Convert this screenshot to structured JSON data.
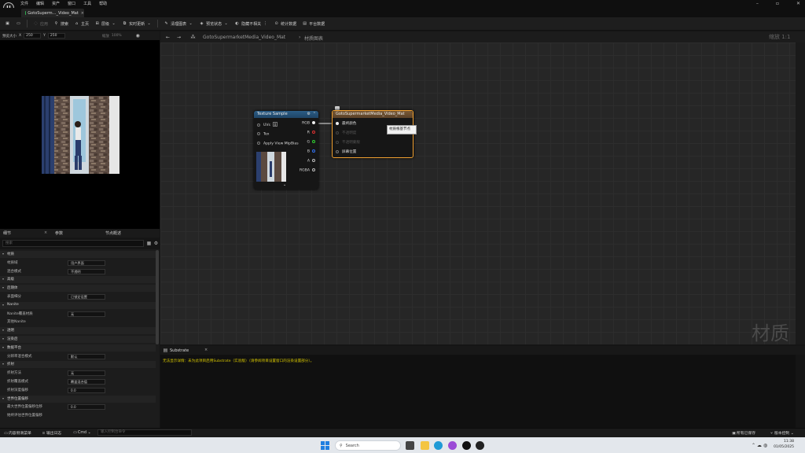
{
  "menu": [
    "文件",
    "编辑",
    "资产",
    "窗口",
    "工具",
    "帮助"
  ],
  "tab": {
    "title": "GotoSuperm..._Video_Mat",
    "close": "×"
  },
  "toolbar": {
    "save": "保存",
    "find_browser": "搜索",
    "apply": "应用",
    "search": "搜索",
    "home": "主页",
    "hierarchy": "层级",
    "live_update": "实时更新",
    "clean": "清理图表",
    "preview_state": "预览状态",
    "hide_unrelated": "隐藏不相关",
    "stats": "统计数据",
    "platform_stats": "平台数据"
  },
  "viewport": {
    "label": "预览大小",
    "x_label": "X",
    "x": "250",
    "y_label": "Y",
    "y": "250",
    "scale_label": "缩放",
    "scale": "100%"
  },
  "details": {
    "tabs": [
      "细节",
      "参数",
      "节点概述"
    ],
    "search_placeholder": "搜索",
    "rows": [
      {
        "type": "sec",
        "key": "材质"
      },
      {
        "type": "prop",
        "key": "材质域",
        "value": "用户界面"
      },
      {
        "type": "prop",
        "key": "混合模式",
        "value": "不透明"
      },
      {
        "type": "sec",
        "key": "高级"
      },
      {
        "type": "sec",
        "key": "后期体"
      },
      {
        "type": "prop",
        "key": "表面细分",
        "value": "已锁定设置"
      },
      {
        "type": "sec",
        "key": "Nanite"
      },
      {
        "type": "prop",
        "key": "Nanite覆盖材质",
        "value": "无"
      },
      {
        "type": "prop",
        "key": "其他Nanite",
        "value": ""
      },
      {
        "type": "sec",
        "key": "透明"
      },
      {
        "type": "sec",
        "key": "渲染后"
      },
      {
        "type": "sec",
        "key": "数据平台"
      },
      {
        "type": "prop",
        "key": "分辨率混合模式",
        "value": "默认"
      },
      {
        "type": "sec",
        "key": "折射"
      },
      {
        "type": "prop",
        "key": "折射方法",
        "value": "无"
      },
      {
        "type": "prop",
        "key": "折射覆盖模式",
        "value": "覆盖混合值"
      },
      {
        "type": "prop",
        "key": "折射深度偏移",
        "value": "0.0"
      },
      {
        "type": "sec",
        "key": "世界位置偏移"
      },
      {
        "type": "prop",
        "key": "最大世界位置偏移位移",
        "value": "0.0"
      },
      {
        "type": "prop",
        "key": "始终评估世界位置偏移",
        "value": ""
      }
    ]
  },
  "graph": {
    "breadcrumb": "GotoSupermarketMedia_Video_Mat",
    "breadcrumb_sub": "材质图表",
    "zoom": "缩放 1:1",
    "watermark": "材质",
    "texture_node": {
      "title": "Texture Sample",
      "inputs": [
        "UVs",
        "Tex",
        "Apply View MipBias"
      ],
      "outputs": [
        "RGB",
        "R",
        "G",
        "B",
        "A",
        "RGBA"
      ],
      "uv_value": "0"
    },
    "material_node": {
      "title": "GotoSupermarketMedia_Video_Mat",
      "pins": [
        "最终颜色",
        "不透明度",
        "不透明蒙版",
        "屏幕位置"
      ]
    },
    "tooltip": "材质根基节点"
  },
  "log": {
    "tab": "Substrate",
    "close": "×",
    "message": "无法显示详情：未为此项目启用Substrate（实验版）（请参阅项目设置窗口的渲染设置部分）。"
  },
  "statusbar": {
    "content_drawer": "内容侧滑菜单",
    "output_log": "输出日志",
    "cmd": "Cmd",
    "cmd_placeholder": "输入控制台命令",
    "saved": "所有已保存",
    "source_control": "版本控制"
  },
  "taskbar": {
    "search": "Search",
    "time": "11:38",
    "date": "01/05/2025"
  }
}
